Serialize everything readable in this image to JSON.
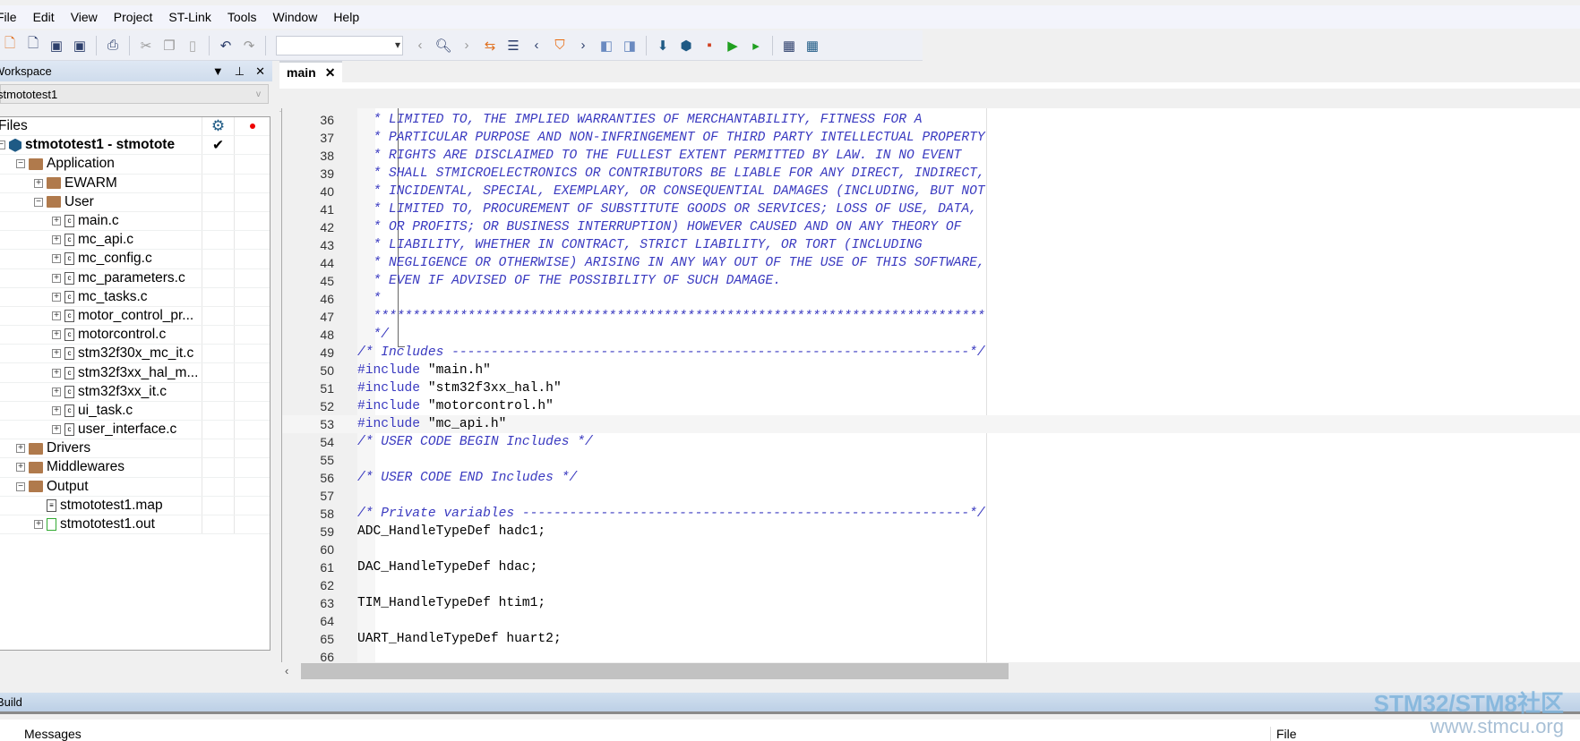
{
  "menu": [
    "File",
    "Edit",
    "View",
    "Project",
    "ST-Link",
    "Tools",
    "Window",
    "Help"
  ],
  "workspace": {
    "title": "Workspace",
    "combo": "stmototest1",
    "files_header": "Files",
    "bottom_tab": "stmototest1",
    "tree": [
      {
        "label": "stmototest1 - stmotote",
        "level": 0,
        "icon": "project",
        "exp": "-",
        "bold": true,
        "check": true
      },
      {
        "label": "Application",
        "level": 1,
        "icon": "folder",
        "exp": "-"
      },
      {
        "label": "EWARM",
        "level": 2,
        "icon": "folder",
        "exp": "+"
      },
      {
        "label": "User",
        "level": 2,
        "icon": "folder",
        "exp": "-"
      },
      {
        "label": "main.c",
        "level": 3,
        "icon": "c",
        "exp": "+"
      },
      {
        "label": "mc_api.c",
        "level": 3,
        "icon": "c",
        "exp": "+"
      },
      {
        "label": "mc_config.c",
        "level": 3,
        "icon": "c",
        "exp": "+"
      },
      {
        "label": "mc_parameters.c",
        "level": 3,
        "icon": "c",
        "exp": "+"
      },
      {
        "label": "mc_tasks.c",
        "level": 3,
        "icon": "c",
        "exp": "+"
      },
      {
        "label": "motor_control_pr...",
        "level": 3,
        "icon": "c",
        "exp": "+"
      },
      {
        "label": "motorcontrol.c",
        "level": 3,
        "icon": "c",
        "exp": "+"
      },
      {
        "label": "stm32f30x_mc_it.c",
        "level": 3,
        "icon": "c",
        "exp": "+"
      },
      {
        "label": "stm32f3xx_hal_m...",
        "level": 3,
        "icon": "c",
        "exp": "+"
      },
      {
        "label": "stm32f3xx_it.c",
        "level": 3,
        "icon": "c",
        "exp": "+"
      },
      {
        "label": "ui_task.c",
        "level": 3,
        "icon": "c",
        "exp": "+"
      },
      {
        "label": "user_interface.c",
        "level": 3,
        "icon": "c",
        "exp": "+"
      },
      {
        "label": "Drivers",
        "level": 1,
        "icon": "folder",
        "exp": "+"
      },
      {
        "label": "Middlewares",
        "level": 1,
        "icon": "folder",
        "exp": "+"
      },
      {
        "label": "Output",
        "level": 1,
        "icon": "folder",
        "exp": "-"
      },
      {
        "label": "stmototest1.map",
        "level": 2,
        "icon": "map",
        "exp": ""
      },
      {
        "label": "stmototest1.out",
        "level": 2,
        "icon": "out",
        "exp": "+"
      }
    ]
  },
  "editor": {
    "tab": "main",
    "close": "✕",
    "lines": [
      {
        "n": "36",
        "t": "  * LIMITED TO, THE IMPLIED WARRANTIES OF MERCHANTABILITY, FITNESS FOR A",
        "k": "cmt"
      },
      {
        "n": "37",
        "t": "  * PARTICULAR PURPOSE AND NON-INFRINGEMENT OF THIRD PARTY INTELLECTUAL PROPERTY",
        "k": "cmt"
      },
      {
        "n": "38",
        "t": "  * RIGHTS ARE DISCLAIMED TO THE FULLEST EXTENT PERMITTED BY LAW. IN NO EVENT",
        "k": "cmt"
      },
      {
        "n": "39",
        "t": "  * SHALL STMICROELECTRONICS OR CONTRIBUTORS BE LIABLE FOR ANY DIRECT, INDIRECT,",
        "k": "cmt"
      },
      {
        "n": "40",
        "t": "  * INCIDENTAL, SPECIAL, EXEMPLARY, OR CONSEQUENTIAL DAMAGES (INCLUDING, BUT NOT",
        "k": "cmt"
      },
      {
        "n": "41",
        "t": "  * LIMITED TO, PROCUREMENT OF SUBSTITUTE GOODS OR SERVICES; LOSS OF USE, DATA,",
        "k": "cmt"
      },
      {
        "n": "42",
        "t": "  * OR PROFITS; OR BUSINESS INTERRUPTION) HOWEVER CAUSED AND ON ANY THEORY OF",
        "k": "cmt"
      },
      {
        "n": "43",
        "t": "  * LIABILITY, WHETHER IN CONTRACT, STRICT LIABILITY, OR TORT (INCLUDING",
        "k": "cmt"
      },
      {
        "n": "44",
        "t": "  * NEGLIGENCE OR OTHERWISE) ARISING IN ANY WAY OUT OF THE USE OF THIS SOFTWARE,",
        "k": "cmt"
      },
      {
        "n": "45",
        "t": "  * EVEN IF ADVISED OF THE POSSIBILITY OF SUCH DAMAGE.",
        "k": "cmt"
      },
      {
        "n": "46",
        "t": "  *",
        "k": "cmt"
      },
      {
        "n": "47",
        "t": "  ******************************************************************************",
        "k": "cmt"
      },
      {
        "n": "48",
        "t": "  */",
        "k": "cmt"
      },
      {
        "n": "49",
        "t": "/* Includes ------------------------------------------------------------------*/",
        "k": "cmt"
      },
      {
        "n": "50",
        "pp": "#include",
        "s": " \"main.h\"",
        "k": "inc"
      },
      {
        "n": "51",
        "pp": "#include",
        "s": " \"stm32f3xx_hal.h\"",
        "k": "inc"
      },
      {
        "n": "52",
        "pp": "#include",
        "s": " \"motorcontrol.h\"",
        "k": "inc"
      },
      {
        "n": "53",
        "pp": "#include",
        "s": " \"mc_api.h\"",
        "k": "inc",
        "cur": true
      },
      {
        "n": "54",
        "t": "/* USER CODE BEGIN Includes */",
        "k": "cmt"
      },
      {
        "n": "55",
        "t": "",
        "k": ""
      },
      {
        "n": "56",
        "t": "/* USER CODE END Includes */",
        "k": "cmt"
      },
      {
        "n": "57",
        "t": "",
        "k": ""
      },
      {
        "n": "58",
        "t": "/* Private variables ---------------------------------------------------------*/",
        "k": "cmt"
      },
      {
        "n": "59",
        "t": "ADC_HandleTypeDef hadc1;",
        "k": ""
      },
      {
        "n": "60",
        "t": "",
        "k": ""
      },
      {
        "n": "61",
        "t": "DAC_HandleTypeDef hdac;",
        "k": ""
      },
      {
        "n": "62",
        "t": "",
        "k": ""
      },
      {
        "n": "63",
        "t": "TIM_HandleTypeDef htim1;",
        "k": ""
      },
      {
        "n": "64",
        "t": "",
        "k": ""
      },
      {
        "n": "65",
        "t": "UART_HandleTypeDef huart2;",
        "k": ""
      },
      {
        "n": "66",
        "t": "",
        "k": ""
      }
    ]
  },
  "build": {
    "title": "Build",
    "col_messages": "Messages",
    "col_file": "File"
  },
  "watermark": {
    "line1": "STM32/STM8社区",
    "line2": "www.stmcu.org"
  },
  "colors": {
    "comment": "#3a3ac0",
    "accent": "#1e5a85"
  }
}
